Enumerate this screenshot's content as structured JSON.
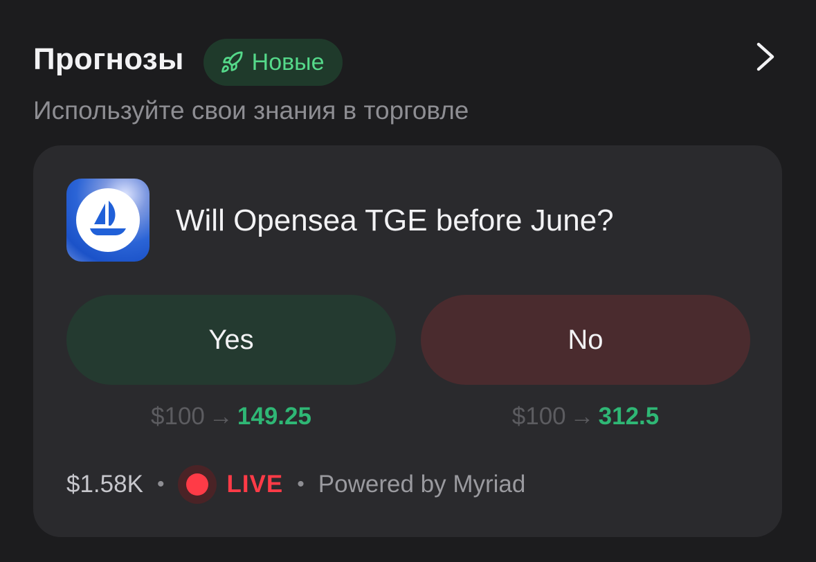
{
  "header": {
    "title": "Прогнозы",
    "badge_label": "Новые",
    "badge_icon": "rocket-icon",
    "nav_icon": "chevron-right-icon"
  },
  "subtitle": "Используйте свои знания в торговле",
  "market": {
    "logo_icon": "opensea-logo",
    "question": "Will Opensea TGE before June?",
    "yes": {
      "label": "Yes",
      "stake": "$100",
      "payout": "149.25"
    },
    "no": {
      "label": "No",
      "stake": "$100",
      "payout": "312.5"
    },
    "arrow": "→",
    "volume": "$1.58K",
    "separator": "•",
    "live_label": "LIVE",
    "powered_by": "Powered by Myriad"
  },
  "colors": {
    "background": "#1c1c1e",
    "card": "#2a2a2d",
    "badge_bg": "#1f3a2b",
    "badge_text": "#55d98a",
    "yes_bg": "#243a30",
    "no_bg": "#4a2b2e",
    "payout_green": "#2fb775",
    "live_red": "#ff3b47"
  }
}
